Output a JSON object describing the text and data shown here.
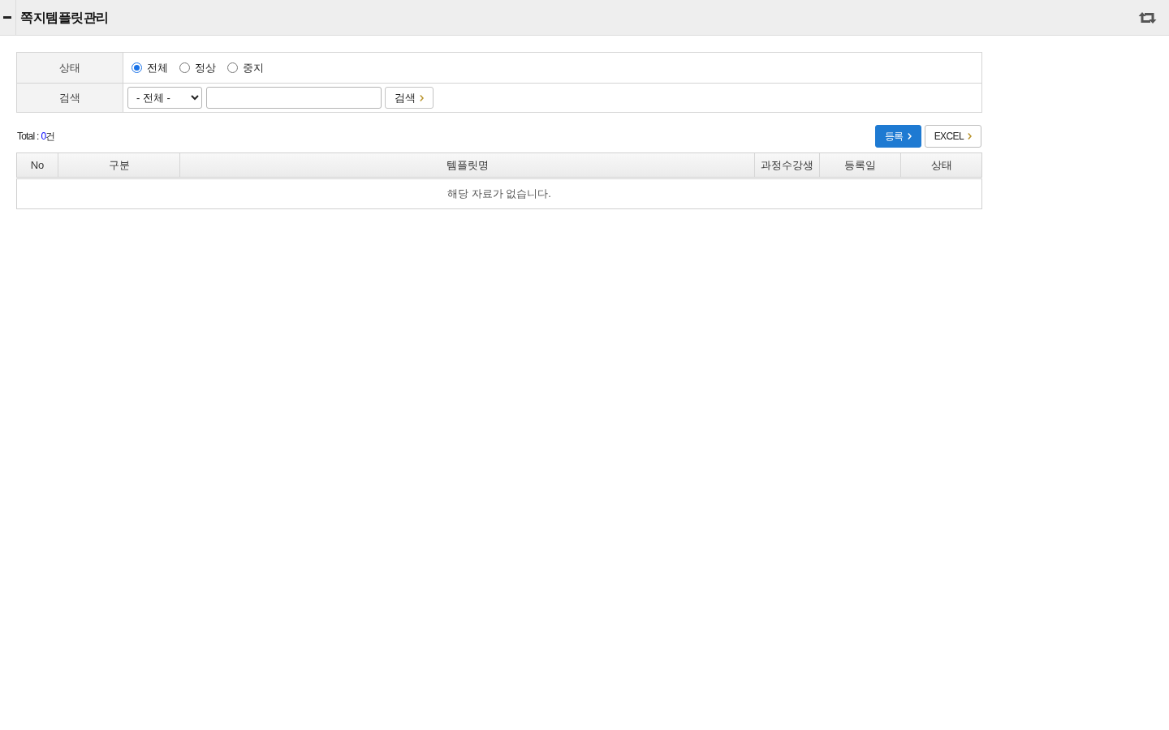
{
  "header": {
    "title": "쪽지템플릿관리"
  },
  "filters": [
    {
      "kind": "radio",
      "label": "상태",
      "options": [
        {
          "label": "전체",
          "selected": true
        },
        {
          "label": "정상",
          "selected": false
        },
        {
          "label": "중지",
          "selected": false
        }
      ]
    },
    {
      "kind": "search",
      "label": "검색",
      "select": "- 전체 -",
      "button": "검색"
    }
  ],
  "total": {
    "label": "Total :",
    "count": "0",
    "unit": "건"
  },
  "buttons": [
    {
      "kind": "primary",
      "label": "등록"
    },
    {
      "kind": "default",
      "label": "EXCEL"
    }
  ],
  "table": {
    "columns": [
      "No",
      "구분",
      "템플릿명",
      "과정수강생",
      "등록일",
      "상태"
    ],
    "empty_message": "해당 자료가 없습니다."
  }
}
